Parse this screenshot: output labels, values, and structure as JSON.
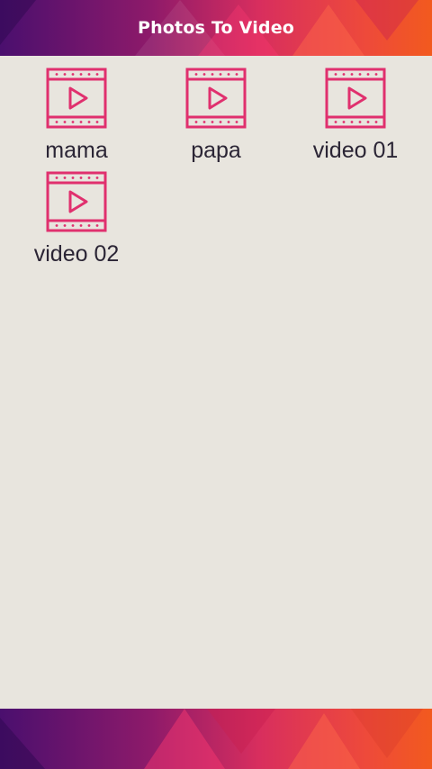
{
  "header": {
    "title": "Photos To Video"
  },
  "videos": [
    {
      "label": "mama",
      "icon": "video-film-icon"
    },
    {
      "label": "papa",
      "icon": "video-film-icon"
    },
    {
      "label": "video 01",
      "icon": "video-film-icon"
    },
    {
      "label": "video 02",
      "icon": "video-film-icon"
    }
  ],
  "colors": {
    "background": "#e8e5de",
    "icon": "#e0306e",
    "label": "#2b2535",
    "banner_purple": "#4a0f6e",
    "banner_pink": "#e8336a",
    "banner_orange": "#f25a1e"
  }
}
